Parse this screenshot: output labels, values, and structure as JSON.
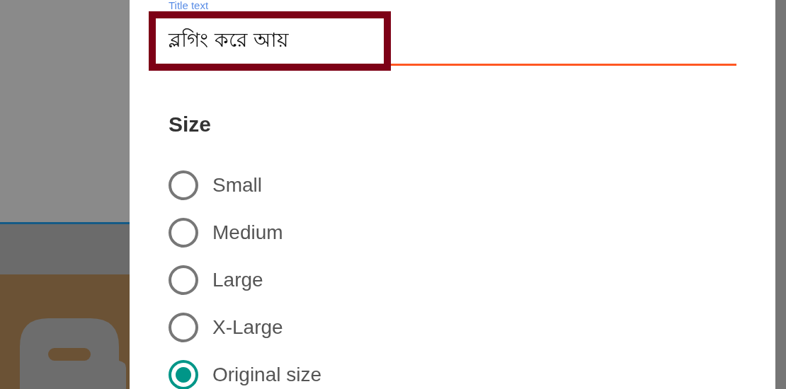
{
  "field": {
    "label": "Title text",
    "value": "ব্লগিং করে আয়"
  },
  "size": {
    "heading": "Size",
    "options": [
      {
        "label": "Small",
        "selected": false
      },
      {
        "label": "Medium",
        "selected": false
      },
      {
        "label": "Large",
        "selected": false
      },
      {
        "label": "X-Large",
        "selected": false
      },
      {
        "label": "Original size",
        "selected": true
      }
    ]
  }
}
